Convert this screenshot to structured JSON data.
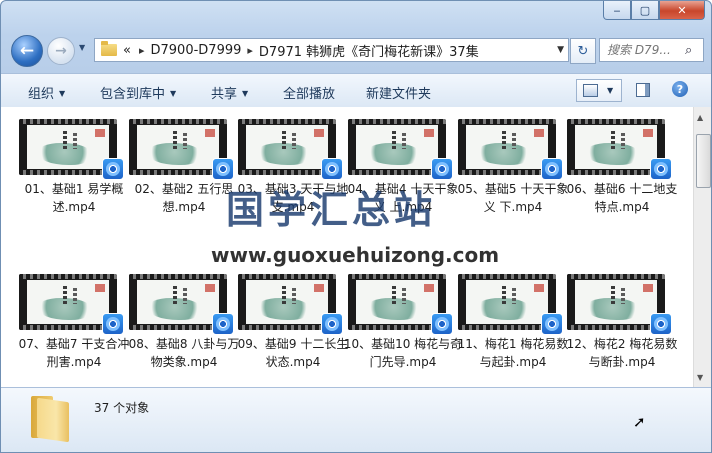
{
  "window": {
    "controls": {
      "minimize": "‒",
      "maximize": "▢",
      "close": "✕"
    }
  },
  "nav": {
    "back_glyph": "←",
    "forward_glyph": "→",
    "address": {
      "overflow": "«",
      "crumbs": [
        "D7900-D7999",
        "D7971 韩狮虎《奇门梅花新课》37集"
      ],
      "separator": "▸"
    },
    "search_placeholder": "搜索 D79..."
  },
  "toolbar": {
    "organize": "组织",
    "include_in_library": "包含到库中",
    "share": "共享",
    "play_all": "全部播放",
    "new_folder": "新建文件夹"
  },
  "files": [
    {
      "name": "01、基础1 易学概述.mp4"
    },
    {
      "name": "02、基础2 五行思想.mp4"
    },
    {
      "name": "03、基础3 天干与地支.mp4"
    },
    {
      "name": "04、基础4 十天干象义 上.mp4"
    },
    {
      "name": "05、基础5 十天干象义 下.mp4"
    },
    {
      "name": "06、基础6 十二地支特点.mp4"
    },
    {
      "name": "07、基础7 干支合冲刑害.mp4"
    },
    {
      "name": "08、基础8 八卦与万物类象.mp4"
    },
    {
      "name": "09、基础9 十二长生状态.mp4"
    },
    {
      "name": "10、基础10 梅花与奇门先导.mp4"
    },
    {
      "name": "11、梅花1 梅花易数与起卦.mp4"
    },
    {
      "name": "12、梅花2 梅花易数与断卦.mp4"
    }
  ],
  "status": {
    "count": "37 个对象"
  },
  "watermark": {
    "title": "国学汇总站",
    "url": "www.guoxuehuizong.com"
  },
  "colors": {
    "accent": "#1d63c8",
    "toolbar_text": "#1e395b",
    "watermark": "#1a3b6e"
  }
}
